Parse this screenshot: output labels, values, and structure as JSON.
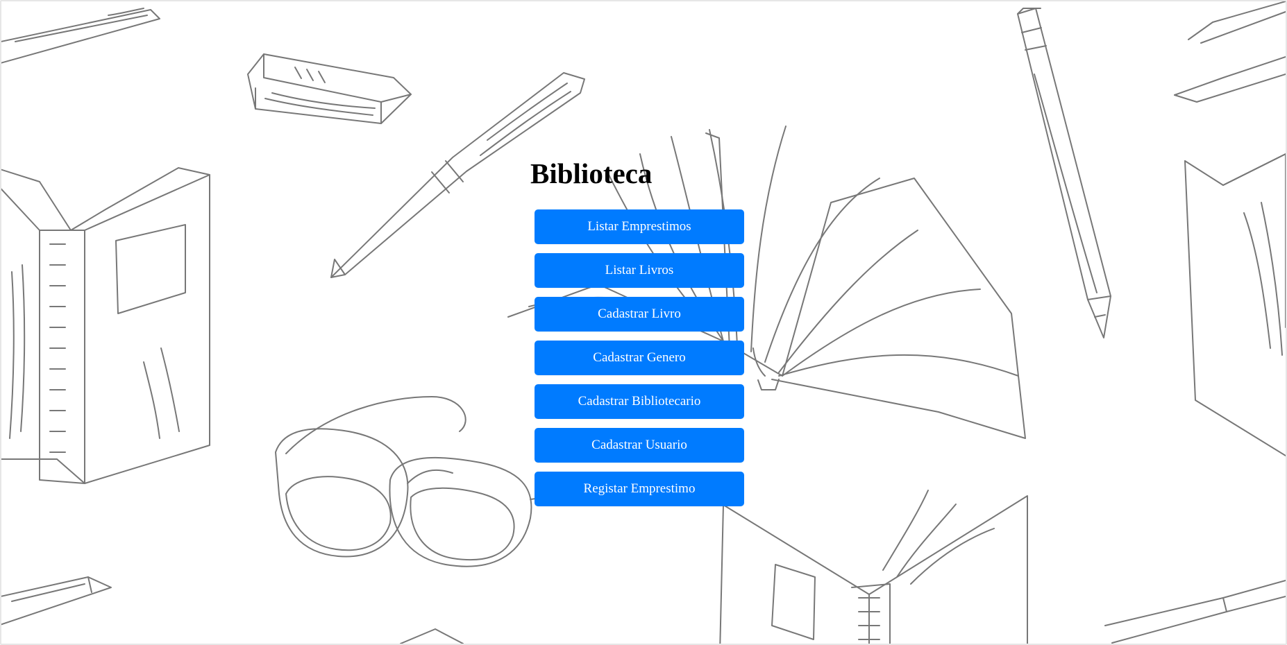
{
  "page": {
    "title": "Biblioteca",
    "buttons": [
      "Listar Emprestimos",
      "Listar Livros",
      "Cadastrar Livro",
      "Cadastrar Genero",
      "Cadastrar Bibliotecario",
      "Cadastrar Usuario",
      "Registar Emprestimo"
    ]
  },
  "theme": {
    "button_color": "#007bff",
    "background": "#ffffff",
    "sketch_color": "#7b7b7b"
  },
  "icons": {
    "background": [
      "open-book-icon",
      "pen-icon",
      "pencil-icon",
      "eraser-icon",
      "glasses-icon"
    ]
  }
}
